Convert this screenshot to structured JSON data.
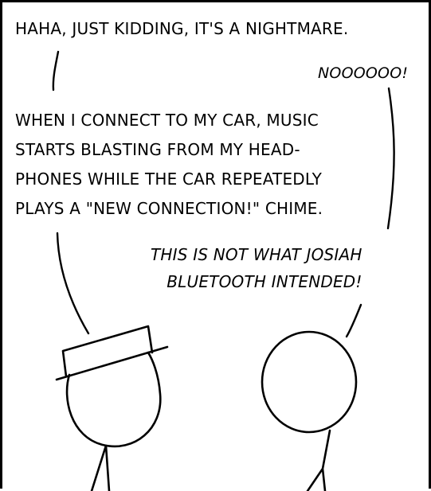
{
  "comic": {
    "line_1": "HAHA, JUST KIDDING, IT'S A NIGHTMARE.",
    "line_2": "NOOOOOO!",
    "line_3": "WHEN I CONNECT TO MY CAR, MUSIC\nSTARTS BLASTING FROM MY HEAD-\nPHONES WHILE THE CAR REPEATEDLY\nPLAYS A \"NEW CONNECTION!\" CHIME.",
    "line_4": "THIS IS NOT WHAT JOSIAH\n    BLUETOOTH INTENDED!"
  }
}
